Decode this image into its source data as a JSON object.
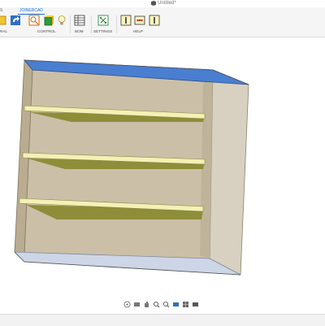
{
  "window": {
    "title": "Untitled*"
  },
  "ribbon": {
    "tabs": [
      "S",
      "JOINERCAD"
    ],
    "groups": [
      "RAL",
      "CONTROL",
      "BOM",
      "SETTINGS",
      "HELP"
    ]
  },
  "icons": {
    "app_logo": "app-logo-icon",
    "tools": [
      "sketch-icon",
      "undo-icon",
      "inspect-icon",
      "solid-box-icon",
      "light-bulb-icon",
      "table-grid-icon",
      "settings-tree-icon",
      "info-icon",
      "comments-icon",
      "help-icon"
    ],
    "navigation": [
      "orbit-icon",
      "look-at-icon",
      "pan-icon",
      "zoom-icon",
      "fit-icon",
      "display-settings-icon",
      "grid-settings-icon",
      "viewport-icon"
    ]
  },
  "colors": {
    "accent": "#1a73c9",
    "panel_face": "#cbbfa8",
    "panel_edge": "#7f7560",
    "shelf_top": "#f3f1b5",
    "shelf_underside": "#8e8d3a",
    "selected_face": "#4a7ed1"
  }
}
